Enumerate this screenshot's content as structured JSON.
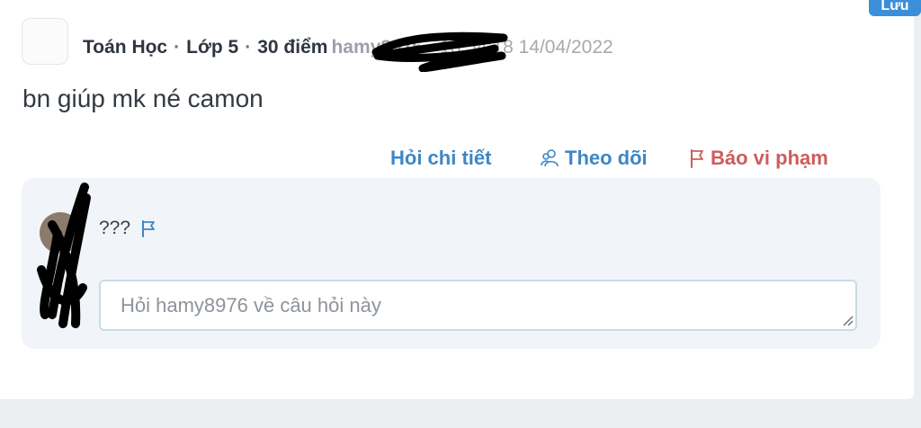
{
  "header": {
    "save_label": "Lưu"
  },
  "question": {
    "subject": "Toán Học",
    "grade": "Lớp 5",
    "points": "30 điểm",
    "separator": "-",
    "timestamp": "18:54:18 14/04/2022",
    "body": "bn giúp mk né camon"
  },
  "actions": {
    "ask_detail": "Hỏi chi tiết",
    "follow": "Theo dõi",
    "report": "Báo vi phạm"
  },
  "comment": {
    "text": "???",
    "reply_placeholder": "Hỏi hamy8976 về câu hỏi này",
    "reply_value": ""
  },
  "colors": {
    "accent_blue": "#3d86c6",
    "report_red": "#cd5c5c",
    "save_bg": "#3b8fd9",
    "comment_bg": "#f1f4f8"
  },
  "icons": {
    "follow": "users-icon",
    "report": "flag-icon",
    "comment_report": "flag-icon"
  }
}
